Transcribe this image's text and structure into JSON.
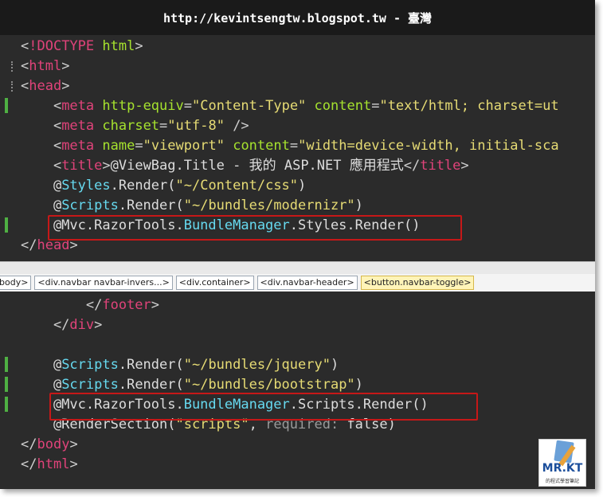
{
  "title": "http://kevintsengtw.blogspot.tw - 臺灣",
  "top_lines": [
    {
      "fold": false,
      "green": false,
      "tokens": [
        [
          "p",
          "<"
        ],
        [
          "tag",
          "!DOCTYPE"
        ],
        [
          "p",
          " "
        ],
        [
          "attr",
          "html"
        ],
        [
          "p",
          ">"
        ]
      ]
    },
    {
      "fold": true,
      "green": false,
      "tokens": [
        [
          "p",
          "<"
        ],
        [
          "tag",
          "html"
        ],
        [
          "p",
          ">"
        ]
      ]
    },
    {
      "fold": true,
      "green": false,
      "tokens": [
        [
          "p",
          "<"
        ],
        [
          "tag",
          "head"
        ],
        [
          "p",
          ">"
        ]
      ]
    },
    {
      "fold": false,
      "green": true,
      "tokens": [
        [
          "p",
          "    <"
        ],
        [
          "tag",
          "meta"
        ],
        [
          "p",
          " "
        ],
        [
          "attr",
          "http-equiv"
        ],
        [
          "p",
          "="
        ],
        [
          "str",
          "\"Content-Type\""
        ],
        [
          "p",
          " "
        ],
        [
          "attr",
          "content"
        ],
        [
          "p",
          "="
        ],
        [
          "str",
          "\"text/html; charset=ut"
        ]
      ]
    },
    {
      "fold": false,
      "green": false,
      "tokens": [
        [
          "p",
          "    <"
        ],
        [
          "tag",
          "meta"
        ],
        [
          "p",
          " "
        ],
        [
          "attr",
          "charset"
        ],
        [
          "p",
          "="
        ],
        [
          "str",
          "\"utf-8\""
        ],
        [
          "p",
          " />"
        ]
      ]
    },
    {
      "fold": false,
      "green": false,
      "tokens": [
        [
          "p",
          "    <"
        ],
        [
          "tag",
          "meta"
        ],
        [
          "p",
          " "
        ],
        [
          "attr",
          "name"
        ],
        [
          "p",
          "="
        ],
        [
          "str",
          "\"viewport\""
        ],
        [
          "p",
          " "
        ],
        [
          "attr",
          "content"
        ],
        [
          "p",
          "="
        ],
        [
          "str",
          "\"width=device-width, initial-sca"
        ]
      ]
    },
    {
      "fold": false,
      "green": false,
      "tokens": [
        [
          "p",
          "    <"
        ],
        [
          "tag",
          "title"
        ],
        [
          "p",
          ">"
        ],
        [
          "razor",
          "@ViewBag.Title - 我的 ASP.NET 應用程式"
        ],
        [
          "p",
          "</"
        ],
        [
          "tag",
          "title"
        ],
        [
          "p",
          ">"
        ]
      ]
    },
    {
      "fold": false,
      "green": false,
      "tokens": [
        [
          "razor",
          "    @"
        ],
        [
          "cls",
          "Styles"
        ],
        [
          "razor",
          ".Render("
        ],
        [
          "str",
          "\"~/Content/css\""
        ],
        [
          "razor",
          ")"
        ]
      ]
    },
    {
      "fold": false,
      "green": false,
      "tokens": [
        [
          "razor",
          "    @"
        ],
        [
          "cls",
          "Scripts"
        ],
        [
          "razor",
          ".Render("
        ],
        [
          "str",
          "\"~/bundles/modernizr\""
        ],
        [
          "razor",
          ")"
        ]
      ]
    },
    {
      "fold": false,
      "green": true,
      "tokens": [
        [
          "razor",
          "    @Mvc.RazorTools."
        ],
        [
          "cls",
          "BundleManager"
        ],
        [
          "razor",
          ".Styles.Render()"
        ]
      ]
    },
    {
      "fold": false,
      "green": false,
      "tokens": [
        [
          "p",
          "</"
        ],
        [
          "tag",
          "head"
        ],
        [
          "p",
          ">"
        ]
      ]
    }
  ],
  "breadcrumb": [
    {
      "label": "body>",
      "active": false
    },
    {
      "label": "<div.navbar navbar-invers...>",
      "active": false
    },
    {
      "label": "<div.container>",
      "active": false
    },
    {
      "label": "<div.navbar-header>",
      "active": false
    },
    {
      "label": "<button.navbar-toggle>",
      "active": true
    }
  ],
  "bottom_lines": [
    {
      "fold": false,
      "green": false,
      "tokens": [
        [
          "p",
          "        </"
        ],
        [
          "tag",
          "footer"
        ],
        [
          "p",
          ">"
        ]
      ]
    },
    {
      "fold": false,
      "green": false,
      "tokens": [
        [
          "p",
          "    </"
        ],
        [
          "tag",
          "div"
        ],
        [
          "p",
          ">"
        ]
      ]
    },
    {
      "fold": false,
      "green": false,
      "tokens": [
        [
          "p",
          ""
        ]
      ]
    },
    {
      "fold": false,
      "green": true,
      "tokens": [
        [
          "razor",
          "    @"
        ],
        [
          "cls",
          "Scripts"
        ],
        [
          "razor",
          ".Render("
        ],
        [
          "str",
          "\"~/bundles/jquery\""
        ],
        [
          "razor",
          ")"
        ]
      ]
    },
    {
      "fold": false,
      "green": true,
      "tokens": [
        [
          "razor",
          "    @"
        ],
        [
          "cls",
          "Scripts"
        ],
        [
          "razor",
          ".Render("
        ],
        [
          "str",
          "\"~/bundles/bootstrap\""
        ],
        [
          "razor",
          ")"
        ]
      ]
    },
    {
      "fold": false,
      "green": true,
      "tokens": [
        [
          "razor",
          "    @Mvc.RazorTools."
        ],
        [
          "cls",
          "BundleManager"
        ],
        [
          "razor",
          ".Scripts.Render()"
        ]
      ]
    },
    {
      "fold": false,
      "green": false,
      "tokens": [
        [
          "razor",
          "    @RenderSection("
        ],
        [
          "str",
          "\"scripts\""
        ],
        [
          "razor",
          ", "
        ],
        [
          "gray",
          "required: "
        ],
        [
          "razor",
          "false)"
        ]
      ]
    },
    {
      "fold": false,
      "green": false,
      "tokens": [
        [
          "p",
          "</"
        ],
        [
          "tag",
          "body"
        ],
        [
          "p",
          ">"
        ]
      ]
    },
    {
      "fold": false,
      "green": false,
      "tokens": [
        [
          "p",
          "</"
        ],
        [
          "tag",
          "html"
        ],
        [
          "p",
          ">"
        ]
      ]
    }
  ],
  "logo": {
    "brand": "MR.KT",
    "tagline": "的程式學習筆記"
  },
  "colors": {
    "background": "#2b2b2b",
    "tag": "#e0437a",
    "attribute": "#a6e22e",
    "string": "#e6db74",
    "class": "#66d9ef",
    "highlight": "#c61818",
    "change_mark": "#4fb043"
  }
}
